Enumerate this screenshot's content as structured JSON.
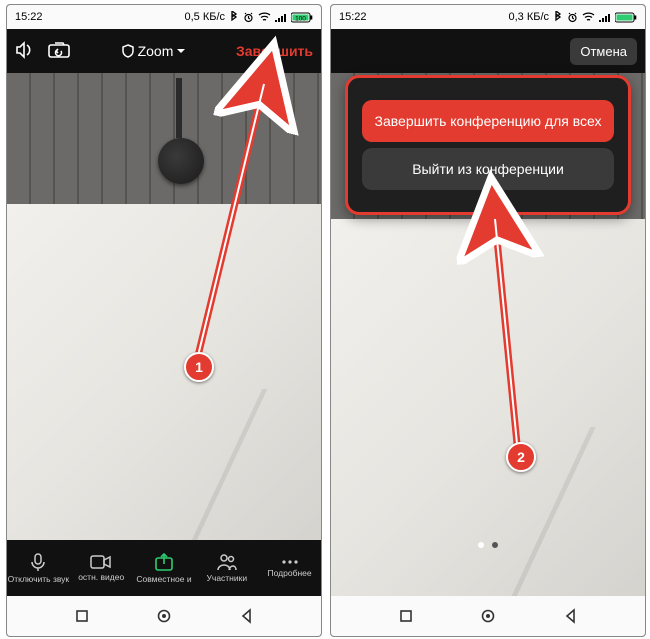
{
  "statusbar": {
    "time": "15:22",
    "net_speed_left": "0,5 КБ/с",
    "net_speed_right": "0,3 КБ/с",
    "battery": "100"
  },
  "topbar": {
    "app_label": "Zoom",
    "end_label": "Завершить",
    "cancel_label": "Отмена"
  },
  "zoombar": {
    "items": [
      {
        "label": "Отключить звук"
      },
      {
        "label": "остн. видео"
      },
      {
        "label": "Совместное и"
      },
      {
        "label": "Участники"
      },
      {
        "label": "Подробнее"
      }
    ]
  },
  "dialog": {
    "end_all": "Завершить конференцию для всех",
    "leave": "Выйти из конференции"
  },
  "annotations": {
    "badge1": "1",
    "badge2": "2"
  }
}
